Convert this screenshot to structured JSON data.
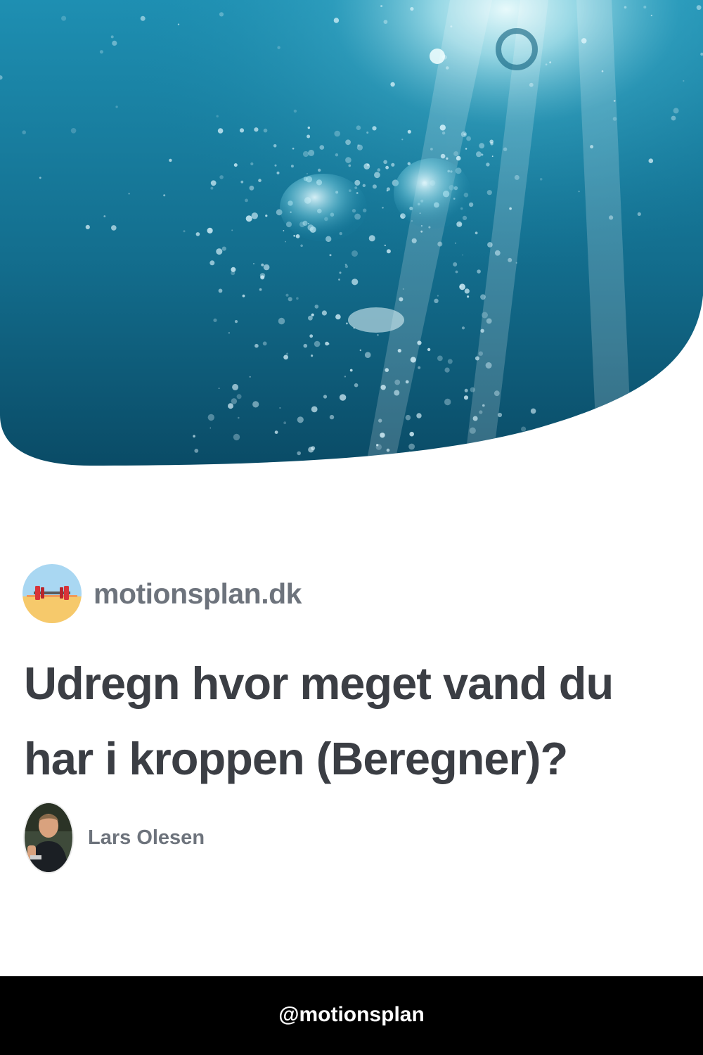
{
  "hero": {
    "image": "underwater-bubbles-photo",
    "colors": {
      "deep": "#0b4a66",
      "mid": "#1a86a8",
      "light": "#7fd4e6"
    }
  },
  "site": {
    "logo_icon": "dumbbell-beach-icon",
    "name": "motionsplan.dk"
  },
  "article": {
    "title": "Udregn hvor meget vand du har i kroppen (Beregner)?"
  },
  "author": {
    "avatar_icon": "author-photo",
    "name": "Lars Olesen"
  },
  "footer": {
    "handle": "@motionsplan"
  }
}
